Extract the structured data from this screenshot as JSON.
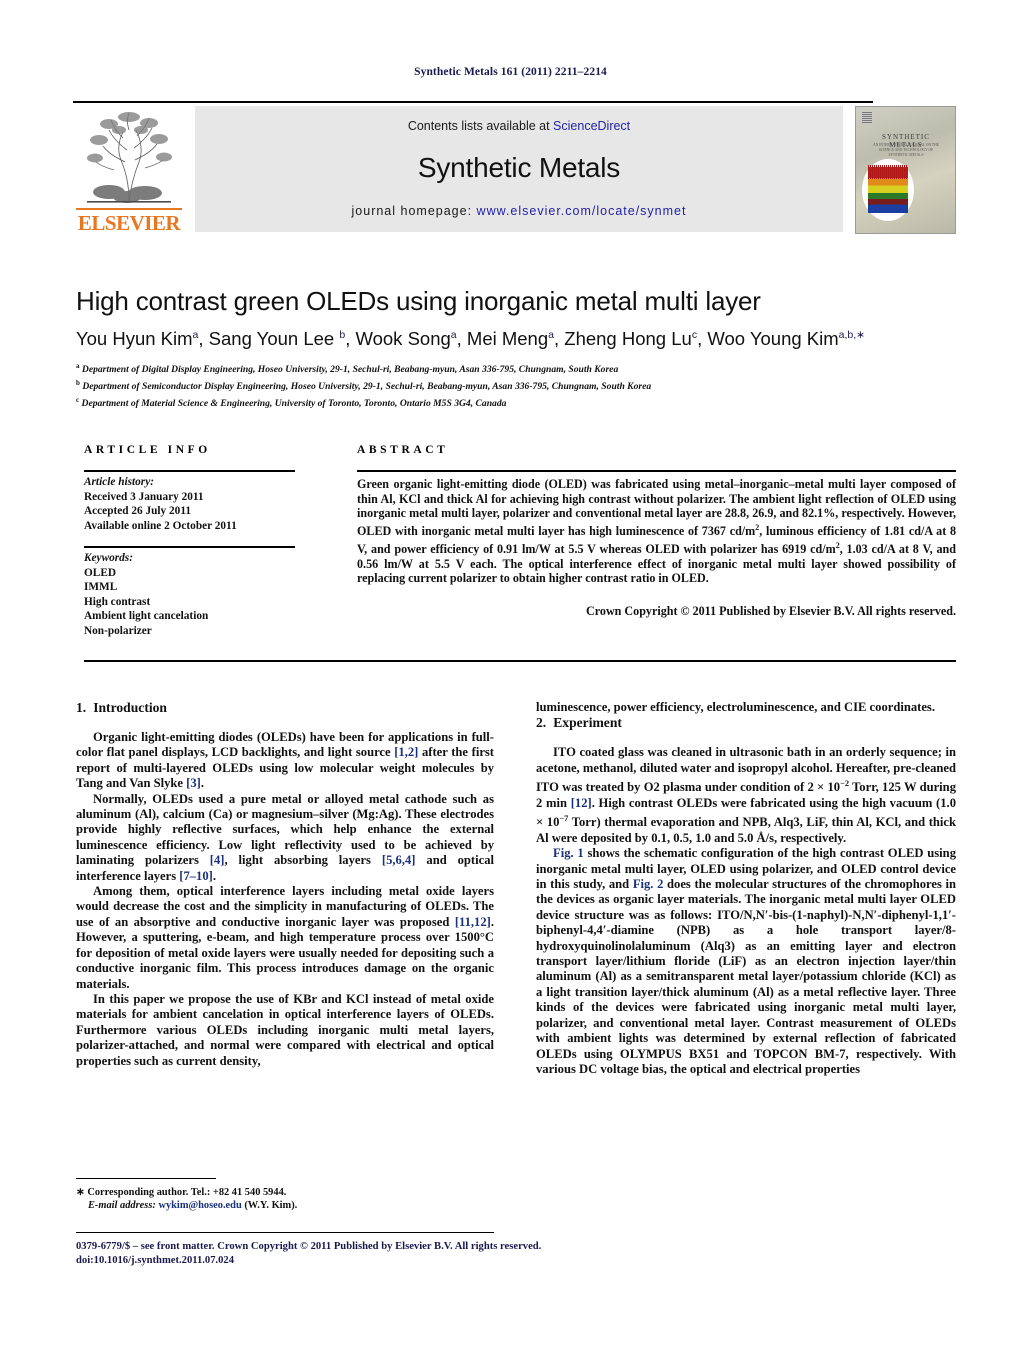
{
  "running_head": "Synthetic Metals 161 (2011) 2211–2214",
  "banner": {
    "publisher_logo_name": "ELSEVIER",
    "contents_prefix": "Contents lists available at ",
    "contents_link": "ScienceDirect",
    "journal_name": "Synthetic Metals",
    "homepage_prefix": "journal homepage: ",
    "homepage_url": "www.elsevier.com/locate/synmet",
    "cover_title": "SYNTHETIC METALS",
    "cover_subtitle": "AN INTERNATIONAL JOURNAL ON THE SCIENCE AND TECHNOLOGY OF SYNTHETIC METALS"
  },
  "article": {
    "title": "High contrast green OLEDs using inorganic metal multi layer",
    "authors": [
      {
        "name": "You Hyun Kim",
        "marks": "a"
      },
      {
        "name": "Sang Youn Lee",
        "marks": "b"
      },
      {
        "name": "Wook Song",
        "marks": "a"
      },
      {
        "name": "Mei Meng",
        "marks": "a"
      },
      {
        "name": "Zheng Hong Lu",
        "marks": "c"
      },
      {
        "name": "Woo Young Kim",
        "marks": "a,b,∗"
      }
    ],
    "affiliations": [
      {
        "mark": "a",
        "text": "Department of Digital Display Engineering, Hoseo University, 29-1, Sechul-ri, Beabang-myun, Asan 336-795, Chungnam, South Korea"
      },
      {
        "mark": "b",
        "text": "Department of Semiconductor Display Engineering, Hoseo University, 29-1, Sechul-ri, Beabang-myun, Asan 336-795, Chungnam, South Korea"
      },
      {
        "mark": "c",
        "text": "Department of Material Science & Engineering, University of Toronto, Toronto, Ontario M5S 3G4, Canada"
      }
    ]
  },
  "info": {
    "heading": "ARTICLE INFO",
    "history_label": "Article history:",
    "history": [
      "Received 3 January 2011",
      "Accepted 26 July 2011",
      "Available online 2 October 2011"
    ],
    "keywords_label": "Keywords:",
    "keywords": [
      "OLED",
      "IMML",
      "High contrast",
      "Ambient light cancelation",
      "Non-polarizer"
    ]
  },
  "abstract": {
    "heading": "ABSTRACT",
    "text_parts": [
      "Green organic light-emitting diode (OLED) was fabricated using metal–inorganic–metal multi layer composed of thin Al, KCl and thick Al for achieving high contrast without polarizer. The ambient light reflection of OLED using inorganic metal multi layer, polarizer and conventional metal layer are 28.8, 26.9, and 82.1%, respectively. However, OLED with inorganic metal multi layer has high luminescence of 7367 cd/m",
      "2",
      ", luminous efficiency of 1.81 cd/A at 8 V, and power efficiency of 0.91 lm/W at 5.5 V whereas OLED with polarizer has 6919 cd/m",
      "2",
      ", 1.03 cd/A at 8 V, and 0.56 lm/W at 5.5 V each. The optical interference effect of inorganic metal multi layer showed possibility of replacing current polarizer to obtain higher contrast ratio in OLED."
    ],
    "copyright": "Crown Copyright © 2011 Published by Elsevier B.V. All rights reserved."
  },
  "body": {
    "section1_num": "1.",
    "section1_title": "Introduction",
    "p1_a": "Organic light-emitting diodes (OLEDs) have been for applications in full-color flat panel displays, LCD backlights, and light source ",
    "p1_ref1": "[1,2]",
    "p1_b": " after the first report of multi-layered OLEDs using low molecular weight molecules by Tang and Van Slyke ",
    "p1_ref2": "[3]",
    "p1_c": ".",
    "p2_a": "Normally, OLEDs used a pure metal or alloyed metal cathode such as aluminum (Al), calcium (Ca) or magnesium–silver (Mg:Ag). These electrodes provide highly reflective surfaces, which help enhance the external luminescence efficiency. Low light reflectivity used to be achieved by laminating polarizers ",
    "p2_ref1": "[4]",
    "p2_b": ", light absorbing layers ",
    "p2_ref2": "[5,6,4]",
    "p2_c": " and optical interference layers ",
    "p2_ref3": "[7–10]",
    "p2_d": ".",
    "p3_a": "Among them, optical interference layers including metal oxide layers would decrease the cost and the simplicity in manufacturing of OLEDs. The use of an absorptive and conductive inorganic layer was proposed ",
    "p3_ref1": "[11,12]",
    "p3_b": ". However, a sputtering, e-beam, and high temperature process over 1500°C for deposition of metal oxide layers were usually needed for depositing such a conductive inorganic film. This process introduces damage on the organic materials.",
    "p4": "In this paper we propose the use of KBr and KCl instead of metal oxide materials for ambient cancelation in optical interference layers of OLEDs. Furthermore various OLEDs including inorganic multi metal layers, polarizer-attached, and normal were compared with electrical and optical properties such as current density,",
    "p5": "luminescence, power efficiency, electroluminescence, and CIE coordinates.",
    "section2_num": "2.",
    "section2_title": "Experiment",
    "p6_a": "ITO coated glass was cleaned in ultrasonic bath in an orderly sequence; in acetone, methanol, diluted water and isopropyl alcohol. Hereafter, pre-cleaned ITO was treated by O2 plasma under condition of 2 × 10",
    "p6_sup1": "−2",
    "p6_b": " Torr, 125 W during 2 min ",
    "p6_ref1": "[12]",
    "p6_c": ". High contrast OLEDs were fabricated using the high vacuum (1.0 × 10",
    "p6_sup2": "−7",
    "p6_d": " Torr) thermal evaporation and NPB, Alq3, LiF, thin Al, KCl, and thick Al were deposited by 0.1, 0.5, 1.0 and 5.0 Å/s, respectively.",
    "p7_fig1": "Fig. 1",
    "p7_a": " shows the schematic configuration of the high contrast OLED using inorganic metal multi layer, OLED using polarizer, and OLED control device in this study, and ",
    "p7_fig2": "Fig. 2",
    "p7_b": " does the molecular structures of the chromophores in the devices as organic layer materials. The inorganic metal multi layer OLED device structure was as follows: ITO/N,N′-bis-(1-naphyl)-N,N′-diphenyl-1,1′-biphenyl-4,4′-diamine (NPB) as a hole transport layer/8-hydroxyquinolinolaluminum (Alq3) as an emitting layer and electron transport layer/lithium floride (LiF) as an electron injection layer/thin aluminum (Al) as a semitransparent metal layer/potassium chloride (KCl) as a light transition layer/thick aluminum (Al) as a metal reflective layer. Three kinds of the devices were fabricated using inorganic metal multi layer, polarizer, and conventional metal layer. Contrast measurement of OLEDs with ambient lights was determined by external reflection of fabricated OLEDs using OLYMPUS BX51 and TOPCON BM-7, respectively. With various DC voltage bias, the optical and electrical properties"
  },
  "footnote": {
    "star": "∗",
    "corresponding": " Corresponding author. Tel.: +82 41 540 5944.",
    "email_label": "E-mail address:",
    "email": "wykim@hoseo.edu",
    "email_owner": " (W.Y. Kim)."
  },
  "footer": {
    "issn_line": "0379-6779/$ – see front matter. Crown Copyright © 2011 Published by Elsevier B.V. All rights reserved.",
    "doi_line": "doi:10.1016/j.synthmet.2011.07.024"
  }
}
